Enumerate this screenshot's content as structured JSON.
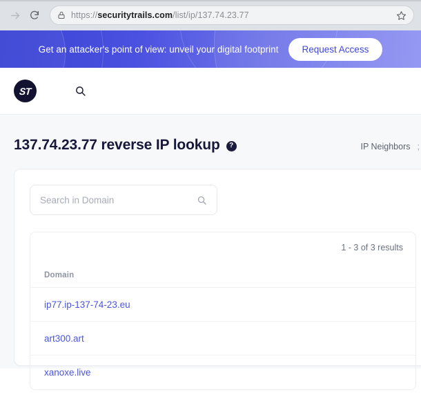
{
  "browser": {
    "forward_icon": "forward-arrow-icon",
    "reload_icon": "reload-icon",
    "lock_icon": "lock-icon",
    "bookmark_icon": "star-icon",
    "url_scheme": "https://",
    "url_host": "securitytrails.com",
    "url_path": "/list/ip/137.74.23.77"
  },
  "promo": {
    "message": "Get an attacker's point of view: unveil your digital footprint",
    "cta_label": "Request Access",
    "gradient_start": "#3a44d4",
    "gradient_end": "#9094f2",
    "cta_text_color": "#3f47d8"
  },
  "navbar": {
    "logo_text": "ST",
    "logo_bg": "#131331",
    "search_icon": "search-icon"
  },
  "page": {
    "title": "137.74.23.77 reverse IP lookup",
    "help_badge": "?",
    "tab_label": "IP Neighbors",
    "tab_cut_label": ";",
    "background": "#f7f8fa"
  },
  "domain_search": {
    "placeholder": "Search in Domain",
    "value": "",
    "icon": "search-icon"
  },
  "results": {
    "count_label": "1 - 3 of 3 results",
    "columns": [
      "Domain"
    ],
    "rows": [
      {
        "domain": "ip77.ip-137-74-23.eu"
      },
      {
        "domain": "art300.art"
      },
      {
        "domain": "xanoxe.live"
      }
    ],
    "link_color": "#4a54e1"
  }
}
